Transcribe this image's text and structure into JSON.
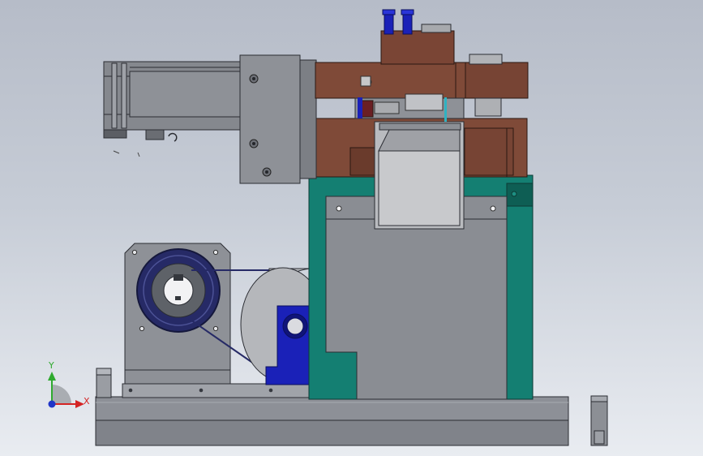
{
  "viewport": {
    "background_top": "#b6bcc8",
    "background_bottom": "#e9ecf1"
  },
  "triad": {
    "y_label": "Y",
    "x_label": "X",
    "y_color": "#2faa2f",
    "x_color": "#d42424",
    "z_color": "#1f35c8"
  },
  "colors": {
    "copper": "#7f4a38",
    "teal": "#147f72",
    "steel": "#8b8f96",
    "dark_gray": "#6f737a",
    "navy": "#242a66",
    "blue_block": "#1a21b8",
    "light_gray": "#b9bbbf",
    "base_gray": "#8a8d93"
  },
  "assembly_parts": [
    "servo-motor",
    "motor-mount-plate",
    "upper-punch-die",
    "lower-die-block",
    "green-frame",
    "gray-housing",
    "scrap-chute",
    "gear-pulley",
    "disc",
    "pillow-block-bearing",
    "base-plate",
    "left-foot",
    "right-foot"
  ]
}
